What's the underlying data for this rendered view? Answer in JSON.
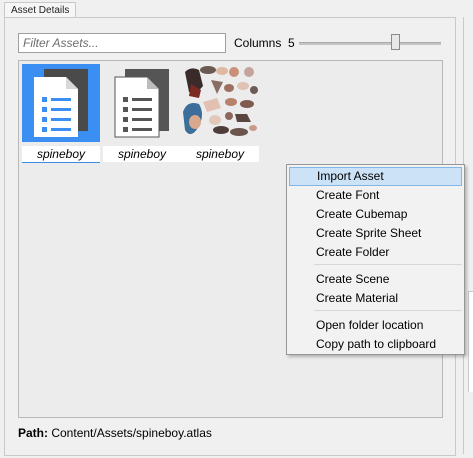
{
  "panel": {
    "tab_title": "Asset Details"
  },
  "toolbar": {
    "filter_placeholder": "Filter Assets...",
    "columns_label": "Columns",
    "columns_value": "5",
    "columns_slider": {
      "min": 1,
      "max": 8,
      "value": 5
    }
  },
  "assets": [
    {
      "name": "spineboy",
      "icon": "document-icon",
      "selected": true
    },
    {
      "name": "spineboy",
      "icon": "document-icon",
      "selected": false
    },
    {
      "name": "spineboy",
      "icon": "sprite-atlas-thumbnail",
      "selected": false
    }
  ],
  "path": {
    "label": "Path:",
    "value": "Content/Assets/spineboy.atlas"
  },
  "context_menu": {
    "items": [
      {
        "label": "Import Asset",
        "highlighted": true
      },
      {
        "label": "Create Font"
      },
      {
        "label": "Create Cubemap"
      },
      {
        "label": "Create Sprite Sheet"
      },
      {
        "label": "Create Folder"
      },
      {
        "label": "Create Scene"
      },
      {
        "label": "Create Material"
      },
      {
        "label": "Open folder location"
      },
      {
        "label": "Copy path to clipboard"
      }
    ]
  },
  "colors": {
    "selection": "#3c8ff2",
    "menu_highlight": "#cce2f6",
    "icon_grey": "#555555"
  }
}
